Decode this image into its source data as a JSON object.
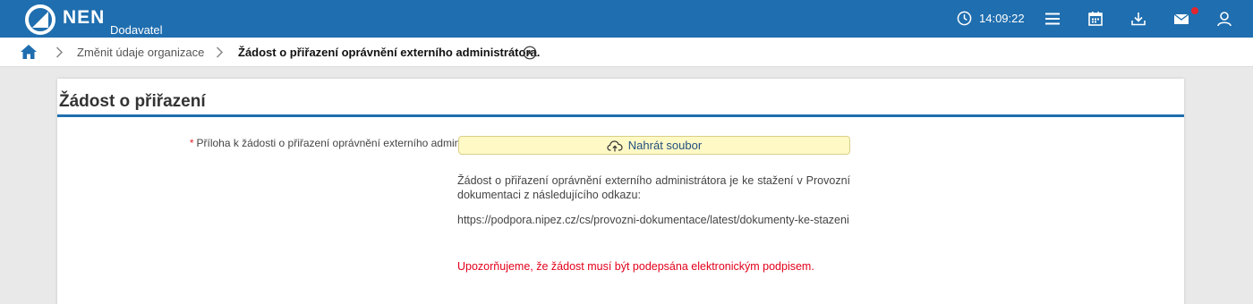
{
  "header": {
    "brand": "NEN",
    "brand_sub": "Dodavatel",
    "time": "14:09:22",
    "icons": [
      "clock-icon",
      "menu-icon",
      "calendar-icon",
      "download-icon",
      "mail-icon",
      "user-icon"
    ],
    "accent": "#1f6eaf",
    "notification_color": "#e3252d"
  },
  "breadcrumb": {
    "items": [
      "Změnit údaje organizace",
      "Žádost o přiřazení oprávnění externího administrátora."
    ]
  },
  "card": {
    "title": "Žádost o přiřazení",
    "field_label": "Příloha k žádosti o přiřazení oprávnění externího administrátora:",
    "required_mark": "*",
    "upload_label": "Nahrát soubor",
    "info_text": "Žádost o přiřazení oprávnění externího administrátora je ke stažení v Provozní dokumentaci z následujícího odkazu:",
    "link_text": "https://podpora.nipez.cz/cs/provozni-dokumentace/latest/dokumenty-ke-stazeni",
    "warning": "Upozorňujeme, že žádost musí být podepsána elektronickým podpisem."
  }
}
